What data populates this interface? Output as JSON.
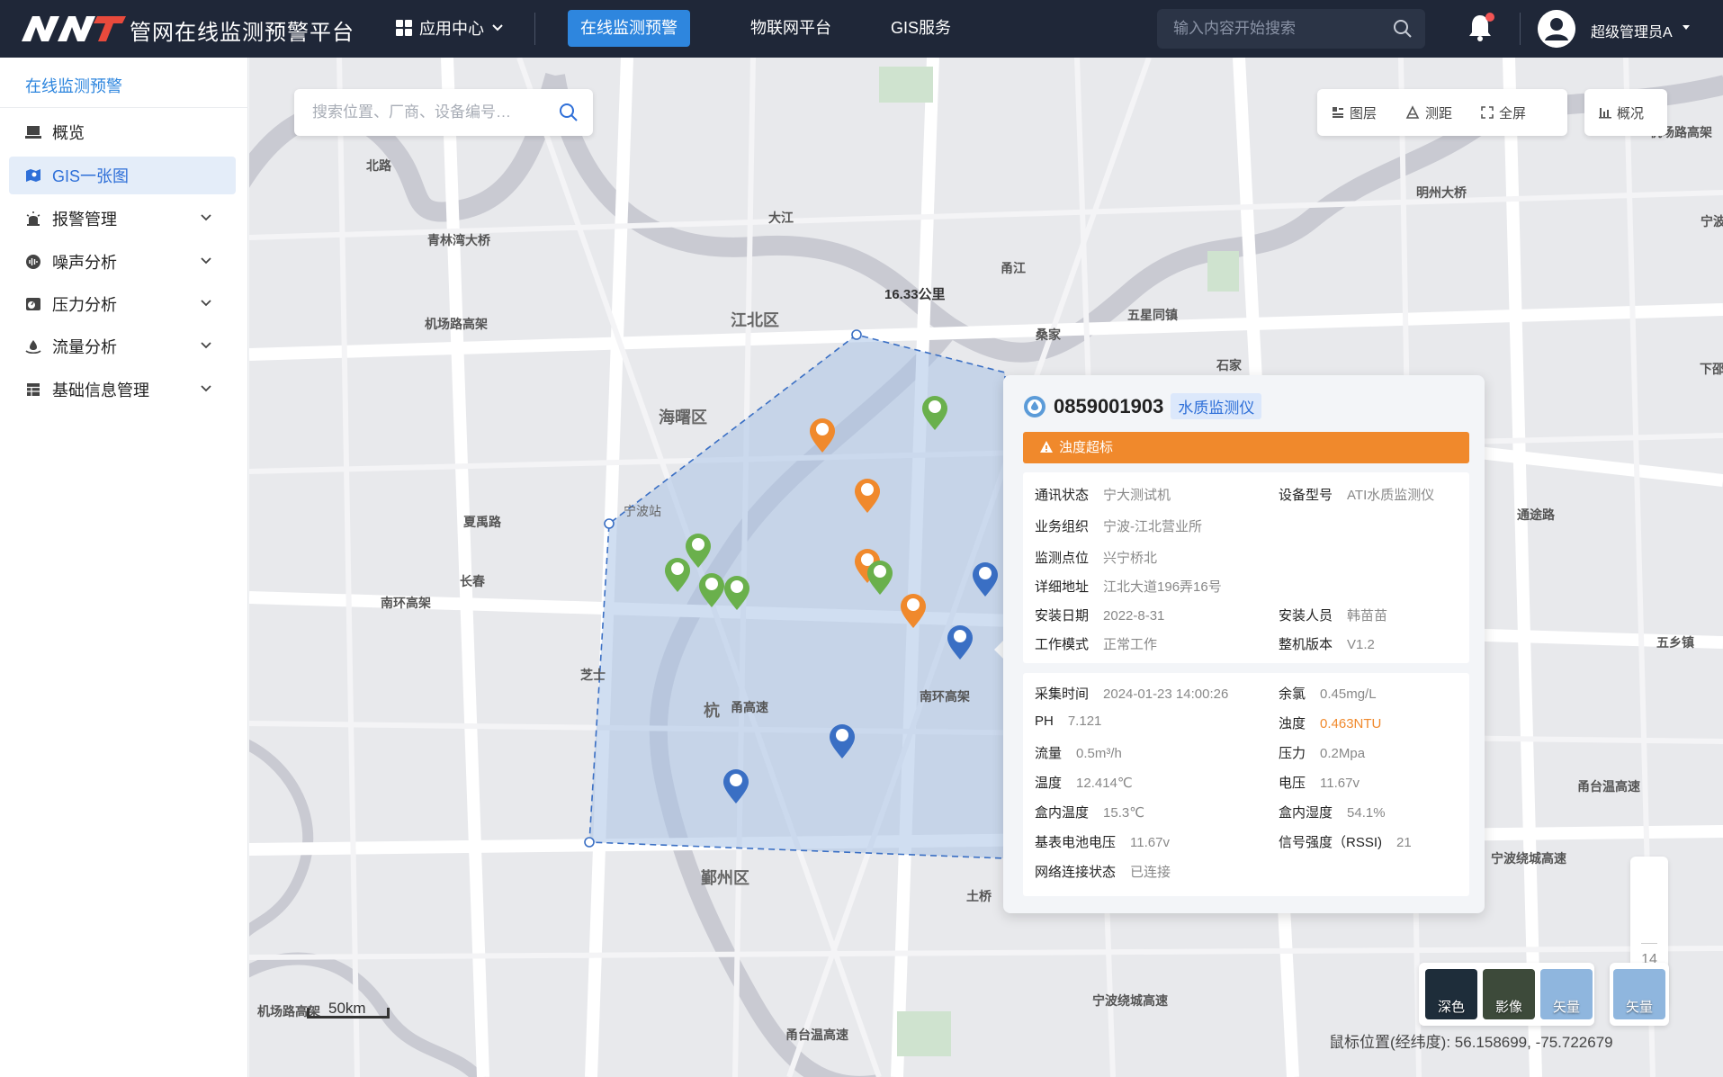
{
  "header": {
    "app_title": "管网在线监测预警平台",
    "app_center_label": "应用中心",
    "nav_tabs": [
      {
        "label": "在线监测预警",
        "active": true
      },
      {
        "label": "物联网平台",
        "active": false
      },
      {
        "label": "GIS服务",
        "active": false
      }
    ],
    "search_placeholder": "输入内容开始搜索",
    "user_name": "超级管理员A"
  },
  "sidebar": {
    "title": "在线监测预警",
    "items": [
      {
        "label": "概览",
        "icon": "monitor-icon",
        "active": false,
        "expandable": false
      },
      {
        "label": "GIS一张图",
        "icon": "map-icon",
        "active": true,
        "expandable": false
      },
      {
        "label": "报警管理",
        "icon": "alarm-icon",
        "active": false,
        "expandable": true
      },
      {
        "label": "噪声分析",
        "icon": "noise-icon",
        "active": false,
        "expandable": true
      },
      {
        "label": "压力分析",
        "icon": "pressure-icon",
        "active": false,
        "expandable": true
      },
      {
        "label": "流量分析",
        "icon": "flow-icon",
        "active": false,
        "expandable": true
      },
      {
        "label": "基础信息管理",
        "icon": "table-icon",
        "active": false,
        "expandable": true
      }
    ]
  },
  "map": {
    "search_placeholder": "搜索位置、厂商、设备编号…",
    "tools": {
      "layers": "图层",
      "measure": "测距",
      "fullscreen": "全屏",
      "overview": "概况"
    },
    "distance_label": "16.33公里",
    "labels": [
      "青林湾大桥",
      "机场路高架",
      "江北区",
      "海曙区",
      "宁波站",
      "夏禹路",
      "长春",
      "南环高架",
      "芝士",
      "杭",
      "甬高速",
      "南环高架",
      "鄞州区",
      "机场路高架",
      "甬台温高速",
      "宁波绕城高速",
      "甬江",
      "五星同镇",
      "桑家",
      "石家",
      "明州大桥",
      "通途路",
      "五乡镇",
      "甬台温高速",
      "宁波绕城高速",
      "大江",
      "北路",
      "机场路高架",
      "土桥",
      "宁波",
      "下邵"
    ],
    "zoom_level": "14",
    "scale_label": "50km",
    "basemaps": [
      "深色",
      "影像",
      "矢量"
    ],
    "active_basemap": "矢量",
    "coords_label": "鼠标位置(经纬度):",
    "coords_value": "56.158699, -75.722679"
  },
  "popup": {
    "device_id": "0859001903",
    "device_type": "水质监测仪",
    "alarm": "浊度超标",
    "info": [
      {
        "k": "通讯状态",
        "v": "宁大测试机"
      },
      {
        "k": "设备型号",
        "v": "ATI水质监测仪"
      },
      {
        "k": "业务组织",
        "v": "宁波-江北营业所"
      },
      {
        "k": "监测点位",
        "v": "兴宁桥北"
      },
      {
        "k": "详细地址",
        "v": "江北大道196弄16号"
      },
      {
        "k": "安装日期",
        "v": "2022-8-31"
      },
      {
        "k": "安装人员",
        "v": "韩苗苗"
      },
      {
        "k": "工作模式",
        "v": "正常工作"
      },
      {
        "k": "整机版本",
        "v": "V1.2"
      }
    ],
    "readings": [
      {
        "k": "采集时间",
        "v": "2024-01-23 14:00:26"
      },
      {
        "k": "余氯",
        "v": "0.45mg/L"
      },
      {
        "k": "PH",
        "v": "7.121"
      },
      {
        "k": "浊度",
        "v": "0.463NTU",
        "alert": true
      },
      {
        "k": "流量",
        "v": "0.5m³/h"
      },
      {
        "k": "压力",
        "v": "0.2Mpa"
      },
      {
        "k": "温度",
        "v": "12.414℃"
      },
      {
        "k": "电压",
        "v": "11.67v"
      },
      {
        "k": "盒内温度",
        "v": "15.3℃"
      },
      {
        "k": "盒内湿度",
        "v": "54.1%"
      },
      {
        "k": "基表电池电压",
        "v": "11.67v"
      },
      {
        "k": "信号强度（RSSI)",
        "v": "21"
      },
      {
        "k": "网络连接状态",
        "v": "已连接"
      }
    ]
  },
  "colors": {
    "header_bg": "#1f2738",
    "accent": "#2e86de",
    "alarm": "#f0892c",
    "marker_green": "#6ab04c",
    "marker_orange": "#f0892c",
    "marker_blue": "#3a6fc4"
  }
}
